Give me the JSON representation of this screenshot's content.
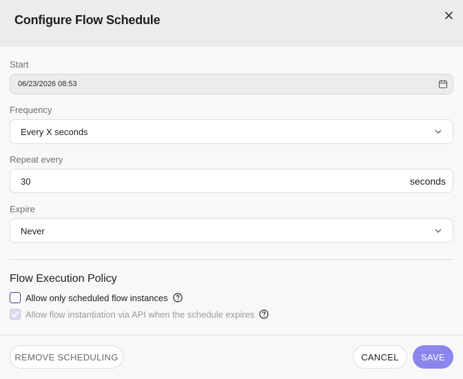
{
  "dialog": {
    "title": "Configure Flow Schedule",
    "close_icon": "close-icon"
  },
  "form": {
    "start": {
      "label": "Start",
      "value": "06/23/2026 08:53",
      "icon": "calendar-icon",
      "disabled": true
    },
    "frequency": {
      "label": "Frequency",
      "value": "Every X seconds",
      "icon": "chevron-down-icon"
    },
    "repeat": {
      "label": "Repeat every",
      "value": "30",
      "suffix": "seconds"
    },
    "expire": {
      "label": "Expire",
      "value": "Never",
      "icon": "chevron-down-icon"
    }
  },
  "policy": {
    "title": "Flow Execution Policy",
    "options": [
      {
        "label": "Allow only scheduled flow instances",
        "checked": false,
        "disabled": false,
        "icon": "help-icon"
      },
      {
        "label": "Allow flow instantiation via API when the schedule expires",
        "checked": true,
        "disabled": true,
        "icon": "help-icon"
      }
    ]
  },
  "footer": {
    "remove_label": "REMOVE SCHEDULING",
    "cancel_label": "CANCEL",
    "save_label": "SAVE"
  },
  "colors": {
    "accent": "#8b85ee",
    "checkbox_border": "#3b3b8f"
  }
}
